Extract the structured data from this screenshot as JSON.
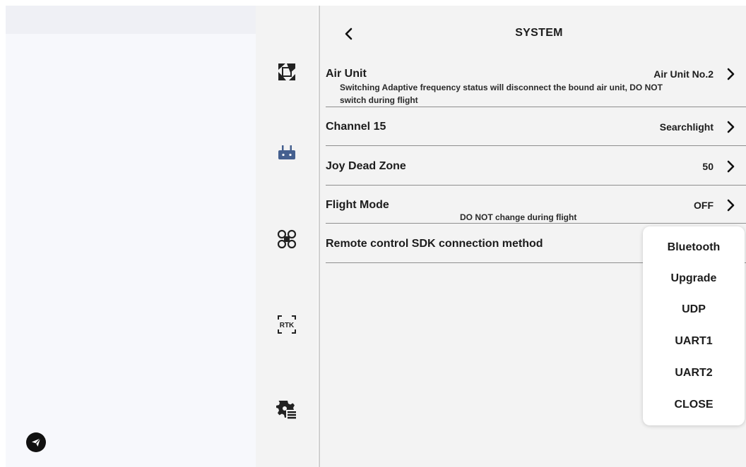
{
  "header": {
    "title": "SYSTEM"
  },
  "settings": {
    "air_unit": {
      "label": "Air Unit",
      "value": "Air Unit No.2",
      "note_line1": "Switching Adaptive frequency status will disconnect the bound air unit, DO NOT",
      "note_line2": "switch during flight"
    },
    "channel": {
      "label": "Channel 15",
      "value": "Searchlight"
    },
    "joy_dead_zone": {
      "label": "Joy Dead Zone",
      "value": "50"
    },
    "flight_mode": {
      "label": "Flight Mode",
      "value": "OFF",
      "note": "DO NOT change during flight"
    },
    "sdk_connection": {
      "label": "Remote control SDK connection method"
    }
  },
  "sdk_options": [
    "Bluetooth",
    "Upgrade",
    "UDP",
    "UART1",
    "UART2",
    "CLOSE"
  ],
  "nav_rail": {
    "items": [
      {
        "icon": "camera-aperture-icon"
      },
      {
        "icon": "remote-controller-icon"
      },
      {
        "icon": "drone-icon"
      },
      {
        "icon": "rtk-icon",
        "text": "RTK"
      },
      {
        "icon": "gear-settings-icon"
      }
    ]
  },
  "colors": {
    "accent_blue": "#45608f",
    "dark": "#1c1c1c",
    "panel": "#f3f3f3"
  }
}
